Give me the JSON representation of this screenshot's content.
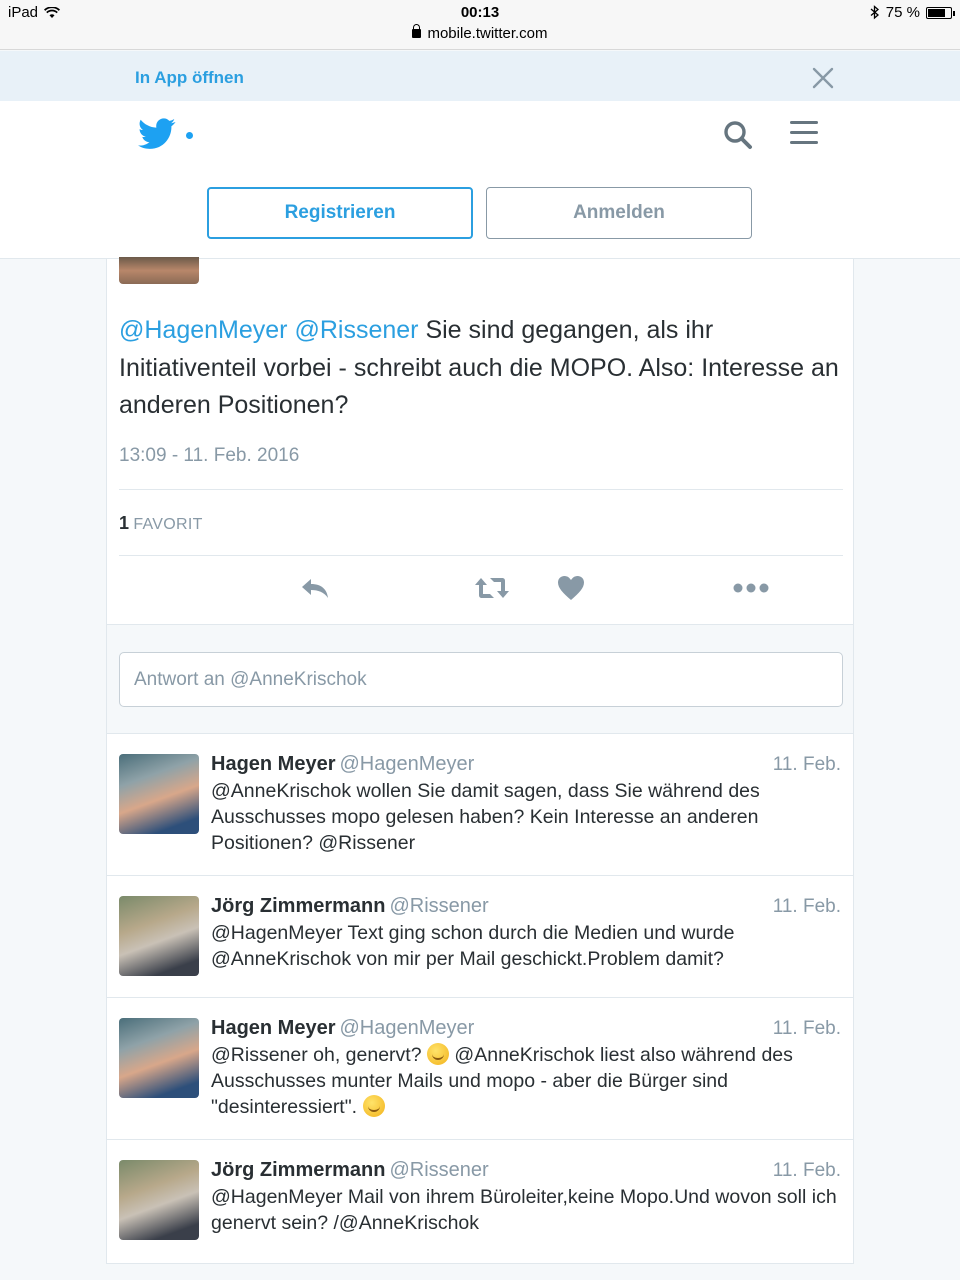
{
  "status_bar": {
    "device": "iPad",
    "time": "00:13",
    "url": "mobile.twitter.com",
    "battery": "75 %",
    "battery_level": 0.75
  },
  "app_banner": {
    "open_label": "In App öffnen"
  },
  "header": {
    "register_label": "Registrieren",
    "login_label": "Anmelden"
  },
  "tweet": {
    "mention1": "@HagenMeyer",
    "mention2": "@Rissener",
    "text": " Sie sind gegangen, als ihr Initiativenteil vorbei - schreibt auch die MOPO. Also: Interesse an anderen Positionen?",
    "timestamp": "13:09 - 11. Feb. 2016",
    "favorites_count": "1",
    "favorites_label": "FAVORIT"
  },
  "reply_box": {
    "placeholder": "Antwort an @AnneKrischok"
  },
  "replies": [
    {
      "name": "Hagen Meyer",
      "handle": "@HagenMeyer",
      "date": "11. Feb.",
      "text": "@AnneKrischok wollen Sie damit sagen, dass Sie während des Ausschusses mopo gelesen haben? Kein Interesse an anderen Positionen? @Rissener"
    },
    {
      "name": "Jörg Zimmermann",
      "handle": "@Rissener",
      "date": "11. Feb.",
      "text": "@HagenMeyer Text ging schon durch die Medien und wurde @AnneKrischok von mir per Mail geschickt.Problem damit?"
    },
    {
      "name": "Hagen Meyer",
      "handle": "@HagenMeyer",
      "date": "11. Feb.",
      "text_a": "@Rissener oh, genervt? ",
      "text_b": " @AnneKrischok liest also während des Ausschusses munter Mails und mopo - aber die Bürger sind \"desinteressiert\". "
    },
    {
      "name": "Jörg Zimmermann",
      "handle": "@Rissener",
      "date": "11. Feb.",
      "text": "@HagenMeyer Mail von ihrem Büroleiter,keine Mopo.Und wovon soll ich genervt sein? /@AnneKrischok"
    }
  ],
  "colors": {
    "twitter_blue": "#1da1f2",
    "link_blue": "#2b9fe0",
    "muted_gray": "#8899a6"
  }
}
